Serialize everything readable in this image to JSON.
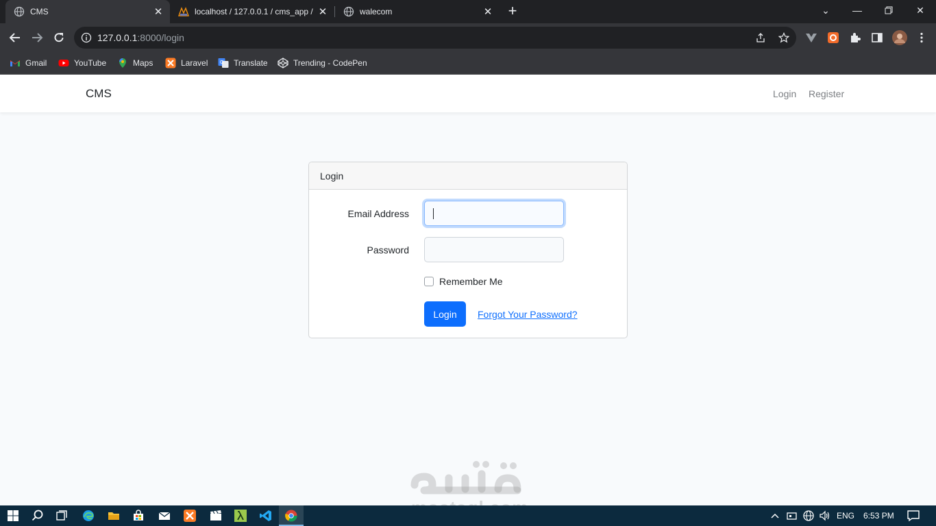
{
  "browser": {
    "tabs": [
      {
        "title": "CMS",
        "icon": "globe-icon",
        "active": true
      },
      {
        "title": "localhost / 127.0.0.1 / cms_app /",
        "icon": "phpmyadmin-icon",
        "active": false
      },
      {
        "title": "walecom",
        "icon": "globe-icon",
        "active": false
      }
    ],
    "new_tab": "+",
    "url_host": "127.0.0.1",
    "url_rest": ":8000/login",
    "bookmarks": [
      {
        "label": "Gmail",
        "icon": "gmail-icon"
      },
      {
        "label": "YouTube",
        "icon": "youtube-icon"
      },
      {
        "label": "Maps",
        "icon": "maps-icon"
      },
      {
        "label": "Laravel",
        "icon": "xampp-icon"
      },
      {
        "label": "Translate",
        "icon": "translate-icon"
      },
      {
        "label": "Trending - CodePen",
        "icon": "codepen-icon"
      }
    ]
  },
  "app": {
    "brand": "CMS",
    "nav": {
      "login": "Login",
      "register": "Register"
    },
    "card": {
      "header": "Login",
      "email_label": "Email Address",
      "password_label": "Password",
      "remember_label": "Remember Me",
      "submit": "Login",
      "forgot": "Forgot Your Password?"
    }
  },
  "watermark": {
    "latin": "mostaql.com"
  },
  "taskbar": {
    "language": "ENG",
    "time": "6:53 PM"
  },
  "colors": {
    "primary": "#0d6efd",
    "chrome_dark": "#202124",
    "chrome_toolbar": "#35363a",
    "taskbar": "#0c2a3e"
  }
}
